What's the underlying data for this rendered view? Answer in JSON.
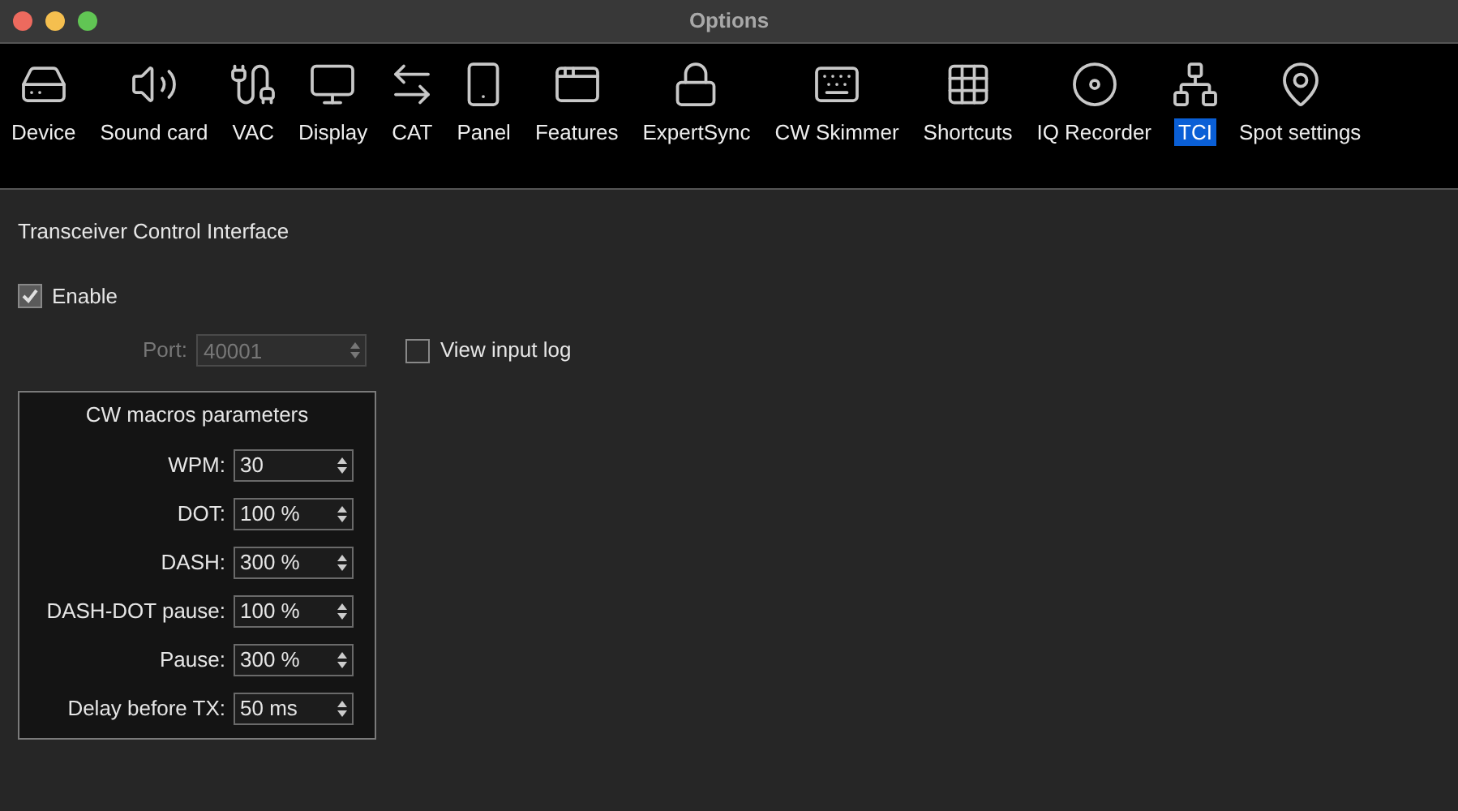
{
  "window": {
    "title": "Options"
  },
  "toolbar": [
    {
      "label": "Device",
      "selected": false
    },
    {
      "label": "Sound card",
      "selected": false
    },
    {
      "label": "VAC",
      "selected": false
    },
    {
      "label": "Display",
      "selected": false
    },
    {
      "label": "CAT",
      "selected": false
    },
    {
      "label": "Panel",
      "selected": false
    },
    {
      "label": "Features",
      "selected": false
    },
    {
      "label": "ExpertSync",
      "selected": false
    },
    {
      "label": "CW Skimmer",
      "selected": false
    },
    {
      "label": "Shortcuts",
      "selected": false
    },
    {
      "label": "IQ Recorder",
      "selected": false
    },
    {
      "label": "TCI",
      "selected": true
    },
    {
      "label": "Spot settings",
      "selected": false
    }
  ],
  "section_title": "Transceiver Control Interface",
  "enable": {
    "label": "Enable",
    "checked": true
  },
  "port": {
    "label": "Port:",
    "value": "40001",
    "disabled": true
  },
  "view_input_log": {
    "label": "View input log",
    "checked": false
  },
  "cw_macros": {
    "title": "CW macros parameters",
    "fields": [
      {
        "label": "WPM:",
        "value": "30"
      },
      {
        "label": "DOT:",
        "value": "100 %"
      },
      {
        "label": "DASH:",
        "value": "300 %"
      },
      {
        "label": "DASH-DOT pause:",
        "value": "100 %"
      },
      {
        "label": "Pause:",
        "value": "300 %"
      },
      {
        "label": "Delay before TX:",
        "value": "50 ms"
      }
    ]
  }
}
